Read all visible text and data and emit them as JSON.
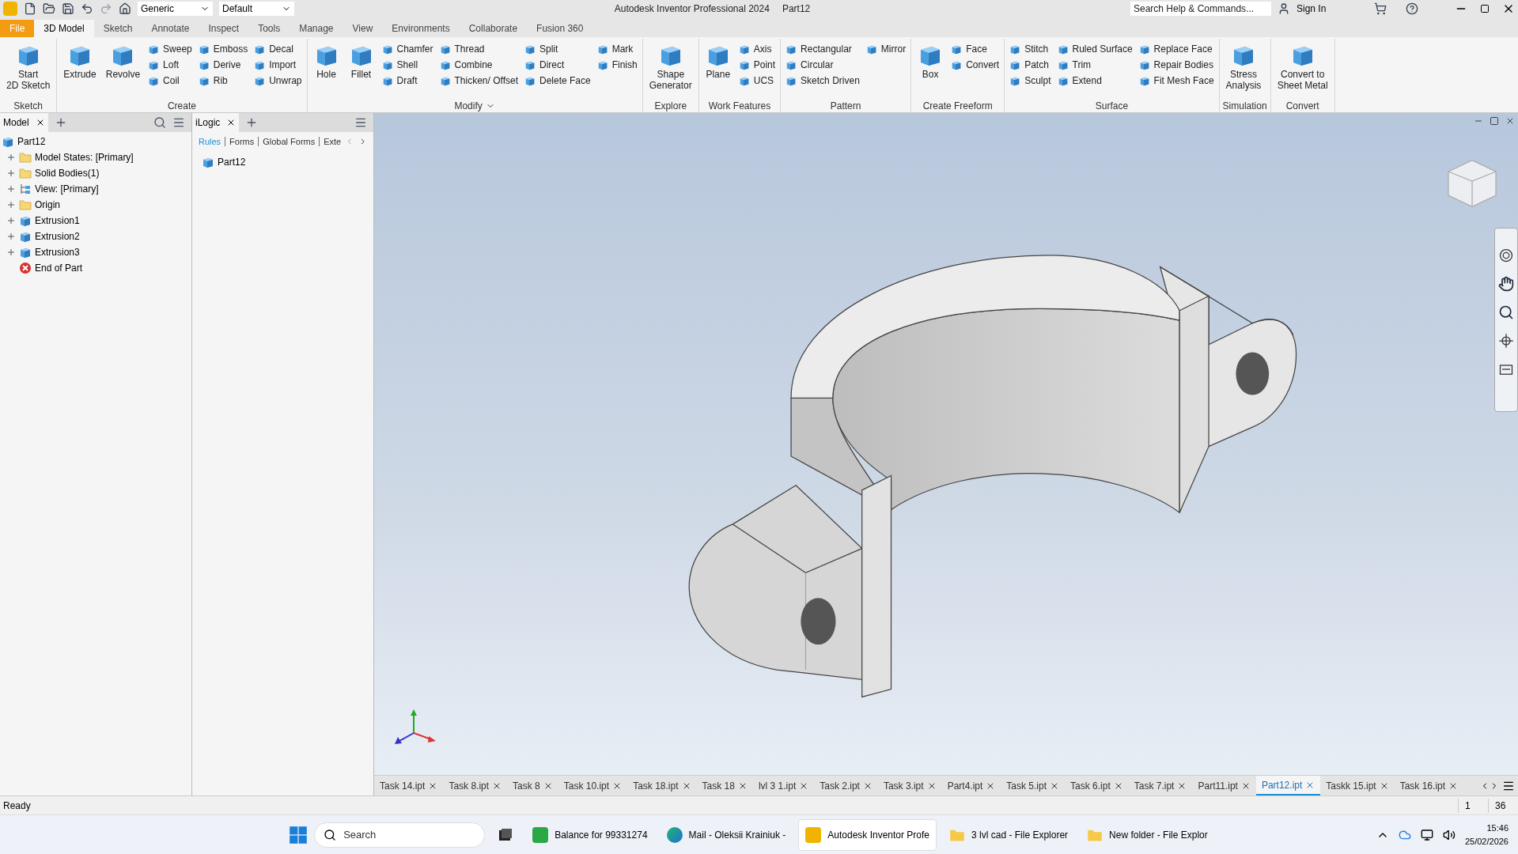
{
  "title_bar": {
    "quick_style": "Generic",
    "appearance": "Default",
    "title": "Autodesk Inventor Professional 2024",
    "document": "Part12",
    "search": {
      "placeholder": "Search Help & Commands..."
    },
    "sign_in": "Sign In"
  },
  "ribbon_tabs": [
    {
      "label": "File",
      "kind": "file",
      "selected": false
    },
    {
      "label": "3D Model",
      "kind": "tab",
      "selected": true
    },
    {
      "label": "Sketch",
      "kind": "tab",
      "selected": false
    },
    {
      "label": "Annotate",
      "kind": "tab",
      "selected": false
    },
    {
      "label": "Inspect",
      "kind": "tab",
      "selected": false
    },
    {
      "label": "Tools",
      "kind": "tab",
      "selected": false
    },
    {
      "label": "Manage",
      "kind": "tab",
      "selected": false
    },
    {
      "label": "View",
      "kind": "tab",
      "selected": false
    },
    {
      "label": "Environments",
      "kind": "tab",
      "selected": false
    },
    {
      "label": "Collaborate",
      "kind": "tab",
      "selected": false
    },
    {
      "label": "Fusion 360",
      "kind": "tab",
      "selected": false
    }
  ],
  "ribbon_groups": [
    {
      "label": "Sketch",
      "large": [
        [
          "Start",
          "2D Sketch"
        ]
      ]
    },
    {
      "label": "Create",
      "large": [
        [
          "Extrude"
        ],
        [
          "Revolve"
        ]
      ],
      "small": [
        "Sweep",
        "Loft",
        "Coil",
        "Emboss",
        "Derive",
        "Rib",
        "Decal",
        "Import",
        "Unwrap"
      ]
    },
    {
      "label": "Modify",
      "menu": true,
      "large": [
        [
          "Hole"
        ],
        [
          "Fillet"
        ]
      ],
      "small": [
        "Chamfer",
        "Shell",
        "Draft",
        "Thread",
        "Combine",
        "Thicken/ Offset",
        "Split",
        "Direct",
        "Delete Face",
        "Mark",
        "Finish"
      ]
    },
    {
      "label": "Explore",
      "large": [
        [
          "Shape",
          "Generator"
        ]
      ]
    },
    {
      "label": "Work Features",
      "large": [
        [
          "Plane"
        ]
      ],
      "small": [
        "Axis",
        "Point",
        "UCS"
      ]
    },
    {
      "label": "Pattern",
      "small": [
        "Rectangular",
        "Circular",
        "Sketch Driven",
        "Mirror"
      ]
    },
    {
      "label": "Create Freeform",
      "large": [
        [
          "Box"
        ]
      ],
      "small": [
        "Face",
        "Convert"
      ]
    },
    {
      "label": "Surface",
      "small": [
        "Stitch",
        "Patch",
        "Sculpt",
        "Ruled Surface",
        "Trim",
        "Extend",
        "Replace Face",
        "Repair Bodies",
        "Fit Mesh Face"
      ]
    },
    {
      "label": "Simulation",
      "large": [
        [
          "Stress",
          "Analysis"
        ]
      ]
    },
    {
      "label": "Convert",
      "large": [
        [
          "Convert to",
          "Sheet Metal"
        ]
      ]
    }
  ],
  "model_panel": {
    "tab": "Model",
    "tree": [
      {
        "label": "Part12",
        "kind": "part",
        "children": [
          {
            "label": "Model States: [Primary]",
            "kind": "folder"
          },
          {
            "label": "Solid Bodies(1)",
            "kind": "folder"
          },
          {
            "label": "View: [Primary]",
            "kind": "view"
          },
          {
            "label": "Origin",
            "kind": "folder"
          },
          {
            "label": "Extrusion1",
            "kind": "feature"
          },
          {
            "label": "Extrusion2",
            "kind": "feature"
          },
          {
            "label": "Extrusion3",
            "kind": "feature"
          },
          {
            "label": "End of Part",
            "kind": "end"
          }
        ]
      }
    ]
  },
  "ilogic_panel": {
    "tab": "iLogic",
    "subtabs": [
      {
        "label": "Rules",
        "selected": true
      },
      {
        "label": "Forms",
        "selected": false
      },
      {
        "label": "Global Forms",
        "selected": false
      },
      {
        "label": "Exte",
        "selected": false
      }
    ],
    "items": [
      "Part12"
    ]
  },
  "document_tabs": [
    {
      "label": "Task 14.ipt",
      "selected": false
    },
    {
      "label": "Task 8.ipt",
      "selected": false
    },
    {
      "label": "Task 8",
      "selected": false
    },
    {
      "label": "Task 10.ipt",
      "selected": false
    },
    {
      "label": "Task 18.ipt",
      "selected": false
    },
    {
      "label": "Task 18",
      "selected": false
    },
    {
      "label": "lvl 3 1.ipt",
      "selected": false
    },
    {
      "label": "Task 2.ipt",
      "selected": false
    },
    {
      "label": "Task 3.ipt",
      "selected": false
    },
    {
      "label": "Part4.ipt",
      "selected": false
    },
    {
      "label": "Task 5.ipt",
      "selected": false
    },
    {
      "label": "Task 6.ipt",
      "selected": false
    },
    {
      "label": "Task 7.ipt",
      "selected": false
    },
    {
      "label": "Part11.ipt",
      "selected": false
    },
    {
      "label": "Part12.ipt",
      "selected": true
    },
    {
      "label": "Taskk 15.ipt",
      "selected": false
    },
    {
      "label": "Task 16.ipt",
      "selected": false
    }
  ],
  "status_bar": {
    "message": "Ready",
    "cells": [
      "1",
      "36"
    ]
  },
  "taskbar": {
    "search": {
      "placeholder": "Search"
    },
    "apps": [
      {
        "label": "Balance for 99331274",
        "kind": "chat",
        "selected": false
      },
      {
        "label": "Mail - Oleksii Krainiuk -",
        "kind": "browser",
        "selected": false
      },
      {
        "label": "Autodesk Inventor Profe",
        "kind": "inventor",
        "selected": true
      },
      {
        "label": "3 lvl cad - File Explorer",
        "kind": "folder",
        "selected": false
      },
      {
        "label": "New folder - File Explor",
        "kind": "folder",
        "selected": false
      }
    ],
    "time": "15:46",
    "date": "25/02/2026"
  }
}
